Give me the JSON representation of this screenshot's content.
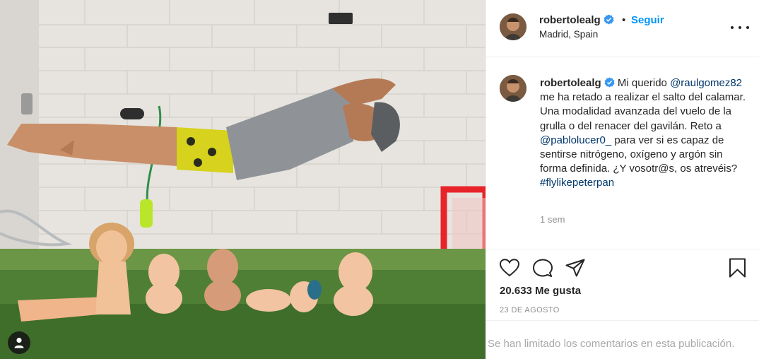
{
  "post": {
    "username": "robertolealg",
    "follow_label": "Seguir",
    "separator": "•",
    "location": "Madrid, Spain",
    "caption": {
      "username": "robertolealg",
      "text_1": "Mi querido",
      "mention_1": "@raulgomez82",
      "text_2": "me ha retado a realizar el salto del calamar. Una modalidad avanzada del vuelo de la grulla o del renacer del gavilán. Reto a",
      "mention_2": "@pablolucer0_",
      "text_3": "para ver si es capaz de sentirse nitrógeno, oxígeno y argón sin forma definida. ¿Y vosotr@s, os atrevéis?",
      "hashtag": "#flylikepeterpan",
      "time": "1 sem"
    },
    "likes": "20.633 Me gusta",
    "date": "23 DE AGOSTO",
    "comments_notice": "Se han limitado los comentarios en esta publicación."
  },
  "icons": {
    "verified": "verified-badge-icon",
    "more": "more-options-icon",
    "like": "heart-icon",
    "comment": "comment-icon",
    "share": "paper-plane-icon",
    "save": "bookmark-icon",
    "tags": "user-tag-icon"
  },
  "colors": {
    "link": "#00376b",
    "follow": "#0095f6",
    "verified": "#3897f0",
    "muted": "#8e8e8e",
    "border": "#efefef"
  }
}
